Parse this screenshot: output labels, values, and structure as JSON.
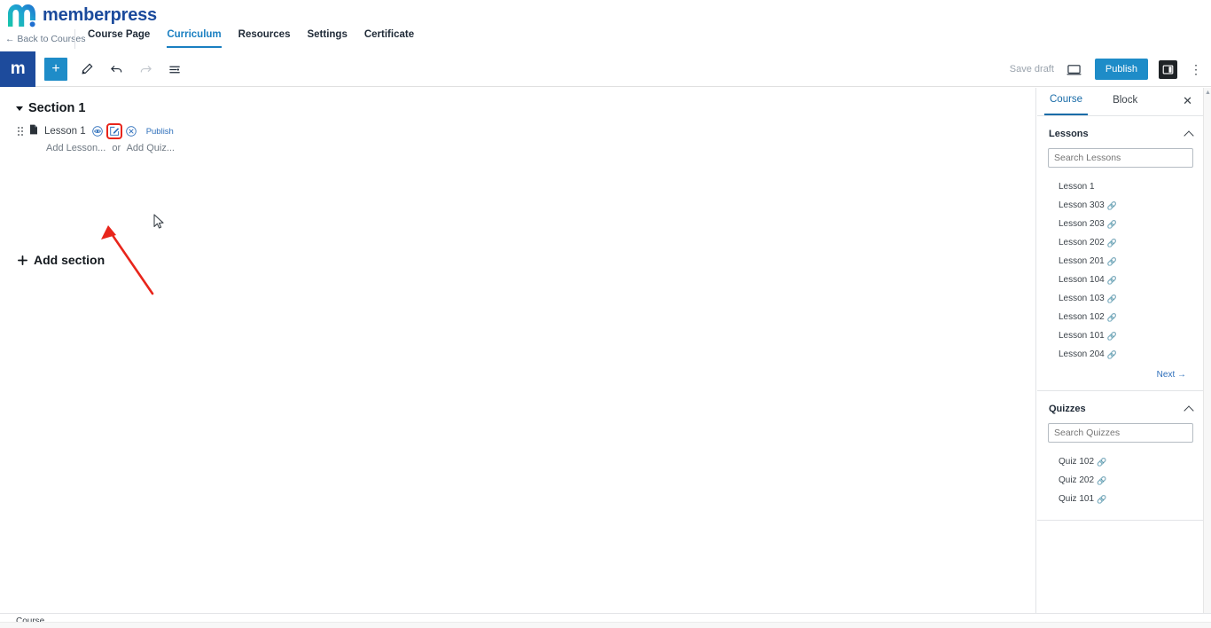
{
  "brand": {
    "logo_icon": "memberpress-m-logo",
    "name": "memberpress",
    "editor_logo_letter": "m"
  },
  "subnav": {
    "back_label": "← Back to Courses",
    "tabs": [
      {
        "label": "Course Page",
        "active": false
      },
      {
        "label": "Curriculum",
        "active": true
      },
      {
        "label": "Resources",
        "active": false
      },
      {
        "label": "Settings",
        "active": false
      },
      {
        "label": "Certificate",
        "active": false
      }
    ]
  },
  "toolbar": {
    "add_block_label": "+",
    "tools": [
      {
        "name": "pen-tool-icon"
      },
      {
        "name": "undo-icon"
      },
      {
        "name": "redo-icon"
      },
      {
        "name": "list-view-icon"
      }
    ],
    "save_draft_label": "Save draft",
    "preview_icon": "preview-monitor-icon",
    "publish_label": "Publish",
    "sidebar_toggle_icon": "settings-sidebar-icon",
    "more_menu_icon": "vertical-ellipsis-icon"
  },
  "curriculum": {
    "section_title": "Section 1",
    "lesson": {
      "name": "Lesson 1",
      "drag_handle_icon": "drag-handle-icon",
      "doc_icon": "document-icon",
      "preview_icon": "eye-preview-icon",
      "edit_icon": "edit-pencil-icon",
      "delete_icon": "delete-close-icon",
      "publish_label": "Publish"
    },
    "add_lesson_label": "Add Lesson...",
    "or_label": "or",
    "add_quiz_label": "Add Quiz...",
    "add_section_label": "Add section",
    "add_section_icon": "plus-icon"
  },
  "sidebar": {
    "tabs": [
      {
        "label": "Course",
        "active": true
      },
      {
        "label": "Block",
        "active": false
      }
    ],
    "close_icon": "close-icon",
    "lessons_panel": {
      "title": "Lessons",
      "collapse_icon": "chevron-up-icon",
      "search_placeholder": "Search Lessons",
      "search_value": "",
      "items": [
        {
          "label": "Lesson 1",
          "has_link": false
        },
        {
          "label": "Lesson 303",
          "has_link": true
        },
        {
          "label": "Lesson 203",
          "has_link": true
        },
        {
          "label": "Lesson 202",
          "has_link": true
        },
        {
          "label": "Lesson 201",
          "has_link": true
        },
        {
          "label": "Lesson 104",
          "has_link": true
        },
        {
          "label": "Lesson 103",
          "has_link": true
        },
        {
          "label": "Lesson 102",
          "has_link": true
        },
        {
          "label": "Lesson 101",
          "has_link": true
        },
        {
          "label": "Lesson 204",
          "has_link": true
        }
      ],
      "next_label": "Next →"
    },
    "quizzes_panel": {
      "title": "Quizzes",
      "collapse_icon": "chevron-up-icon",
      "search_placeholder": "Search Quizzes",
      "search_value": "",
      "items": [
        {
          "label": "Quiz 102",
          "has_link": true
        },
        {
          "label": "Quiz 202",
          "has_link": true
        },
        {
          "label": "Quiz 101",
          "has_link": true
        }
      ]
    }
  },
  "statusbar": {
    "label": "Course"
  },
  "annotation": {
    "highlight_color": "#e8251b",
    "target_icon": "edit-pencil-icon"
  },
  "colors": {
    "brand_blue": "#1b4a9c",
    "accent_blue": "#1e8cc8",
    "link_blue": "#2e6fbb",
    "annotation_red": "#e8251b"
  }
}
